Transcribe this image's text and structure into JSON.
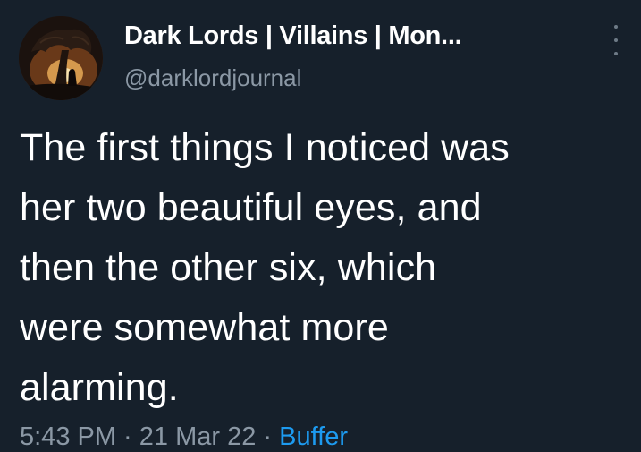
{
  "tweet": {
    "author": {
      "display_name": "Dark Lords | Villains | Mon...",
      "handle": "@darklordjournal",
      "avatar_icon": "dark-lord-tree-avatar"
    },
    "more_icon": "vertical-ellipsis-icon",
    "body_lines": [
      "The first things I noticed was",
      "her two beautiful eyes, and",
      "then the other six, which",
      "were somewhat more",
      "alarming."
    ],
    "time": "5:43 PM",
    "separator": " · ",
    "date": "21 Mar 22",
    "source": "Buffer"
  },
  "colors": {
    "background": "#16202b",
    "text_primary": "#ffffff",
    "text_secondary": "#8b98a5",
    "link": "#1d9bf0"
  }
}
